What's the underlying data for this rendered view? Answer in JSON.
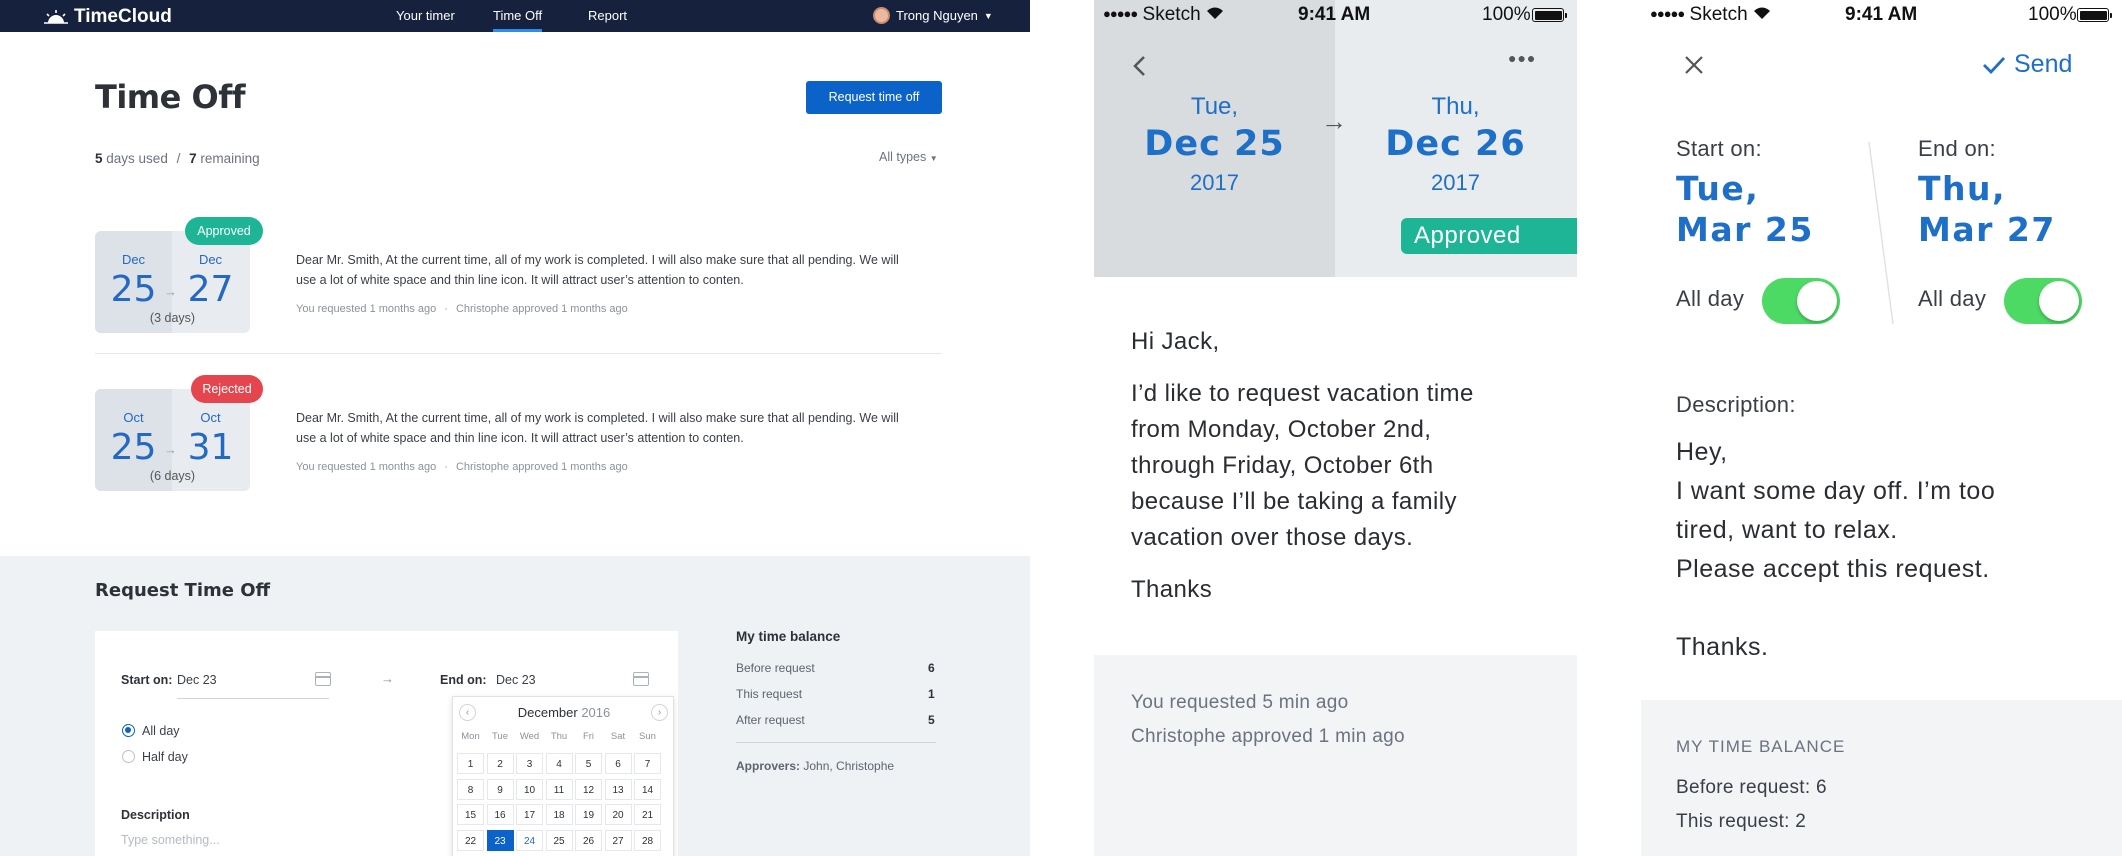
{
  "desktop": {
    "brand": "TimeCloud",
    "nav": [
      "Your timer",
      "Time Off",
      "Report"
    ],
    "user_name": "Trong Nguyen",
    "page_title": "Time Off",
    "request_button": "Request time off",
    "days_used": "5",
    "days_used_label": "days used",
    "separator": "/",
    "days_remaining": "7",
    "days_remaining_label": "remaining",
    "filter": "All types",
    "requests": [
      {
        "start_month": "Dec",
        "start_day": "25",
        "end_month": "Dec",
        "end_day": "27",
        "duration": "(3 days)",
        "status": "Approved",
        "status_color": "#1eb597",
        "message": "Dear Mr. Smith, At the current time, all of my work is completed. I will also make sure that all pending. We will use a lot of white space and thin line icon. It will attract user’s attention to conten.",
        "requested": "You requested 1 months ago",
        "approved": "Christophe approved 1 months ago"
      },
      {
        "start_month": "Oct",
        "start_day": "25",
        "end_month": "Oct",
        "end_day": "31",
        "duration": "(6 days)",
        "status": "Rejected",
        "status_color": "#e5454d",
        "message": "Dear Mr. Smith, At the current time, all of my work is completed. I will also make sure that all pending. We will use a lot of white space and thin line icon. It will attract user’s attention to conten.",
        "requested": "You requested 1 months ago",
        "approved": "Christophe approved 1 months ago"
      }
    ],
    "form": {
      "title": "Request Time Off",
      "start_label": "Start on:",
      "start_value": "Dec 23",
      "end_label": "End on:",
      "end_value": "Dec 23",
      "options": [
        "All day",
        "Half day"
      ],
      "description_label": "Description",
      "description_placeholder": "Type something..."
    },
    "calendar": {
      "month": "December",
      "year": "2016",
      "dow": [
        "Mon",
        "Tue",
        "Wed",
        "Thu",
        "Fri",
        "Sat",
        "Sun"
      ],
      "weeks": [
        [
          "1",
          "2",
          "3",
          "4",
          "5",
          "6",
          "7"
        ],
        [
          "8",
          "9",
          "10",
          "11",
          "12",
          "13",
          "14"
        ],
        [
          "15",
          "16",
          "17",
          "18",
          "19",
          "20",
          "21"
        ],
        [
          "22",
          "23",
          "24",
          "25",
          "26",
          "27",
          "28"
        ]
      ],
      "selected": "23",
      "today": "24"
    },
    "balance": {
      "title": "My time balance",
      "rows": [
        {
          "label": "Before request",
          "value": "6"
        },
        {
          "label": "This request",
          "value": "1"
        },
        {
          "label": "After request",
          "value": "5"
        }
      ],
      "approvers_label": "Approvers:",
      "approvers": "John, Christophe"
    }
  },
  "phone_detail": {
    "carrier": "Sketch",
    "time": "9:41 AM",
    "battery": "100%",
    "start": {
      "dow": "Tue,",
      "date": "Dec 25",
      "year": "2017"
    },
    "end": {
      "dow": "Thu,",
      "date": "Dec 26",
      "year": "2017"
    },
    "status": "Approved",
    "greeting": "Hi Jack,",
    "body": [
      "I’d like to request vacation time",
      "from Monday, October 2nd,",
      "through Friday, October 6th",
      "because I’ll be taking a family",
      "vacation over those days."
    ],
    "closing": "Thanks",
    "requested": "You requested 5 min ago",
    "approved": "Christophe approved 1 min ago"
  },
  "phone_form": {
    "carrier": "Sketch",
    "time": "9:41 AM",
    "battery": "100%",
    "send": "Send",
    "start_label": "Start on:",
    "start_date": [
      "Tue,",
      "Mar 25"
    ],
    "end_label": "End on:",
    "end_date": [
      "Thu,",
      "Mar 27"
    ],
    "all_day": "All day",
    "description_label": "Description:",
    "description": [
      "Hey,",
      "I want some day off. I’m too",
      "tired, want to relax.",
      "Please accept this request."
    ],
    "closing": "Thanks.",
    "balance_title": "MY TIME BALANCE",
    "balance": [
      "Before request: 6",
      "This request: 2"
    ]
  }
}
